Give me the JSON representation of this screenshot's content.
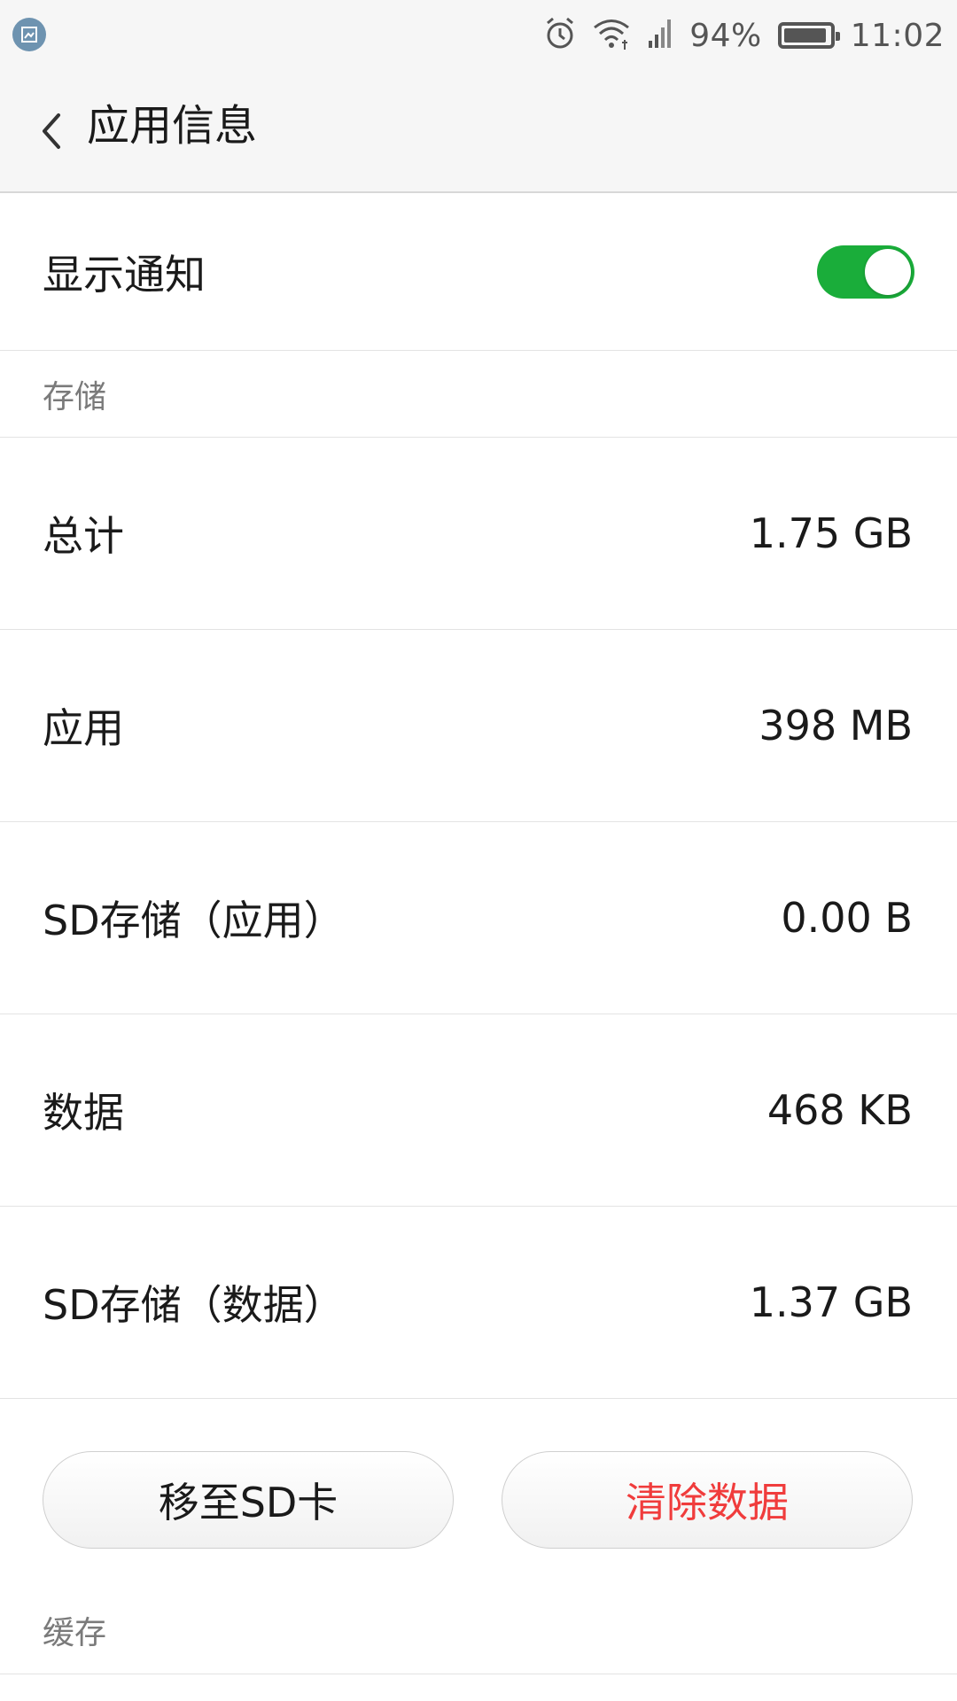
{
  "status_bar": {
    "battery_percent_text": "94%",
    "battery_level": 0.94,
    "time": "11:02",
    "icons": [
      "screenshot-icon",
      "alarm-icon",
      "wifi-icon",
      "signal-icon",
      "battery-icon"
    ]
  },
  "header": {
    "title": "应用信息",
    "back_icon": "chevron-left-icon"
  },
  "notification": {
    "label": "显示通知",
    "enabled": true,
    "toggle_color": "#1aad3a"
  },
  "storage": {
    "section_title": "存储",
    "rows": [
      {
        "label": "总计",
        "value": "1.75 GB"
      },
      {
        "label": "应用",
        "value": "398 MB"
      },
      {
        "label": "SD存储（应用）",
        "value": "0.00 B"
      },
      {
        "label": "数据",
        "value": "468 KB"
      },
      {
        "label": "SD存储（数据）",
        "value": "1.37 GB"
      }
    ]
  },
  "actions": {
    "move_to_sd": "移至SD卡",
    "clear_data": "清除数据",
    "clear_color": "#f03c3c"
  },
  "cache": {
    "section_title": "缓存"
  }
}
